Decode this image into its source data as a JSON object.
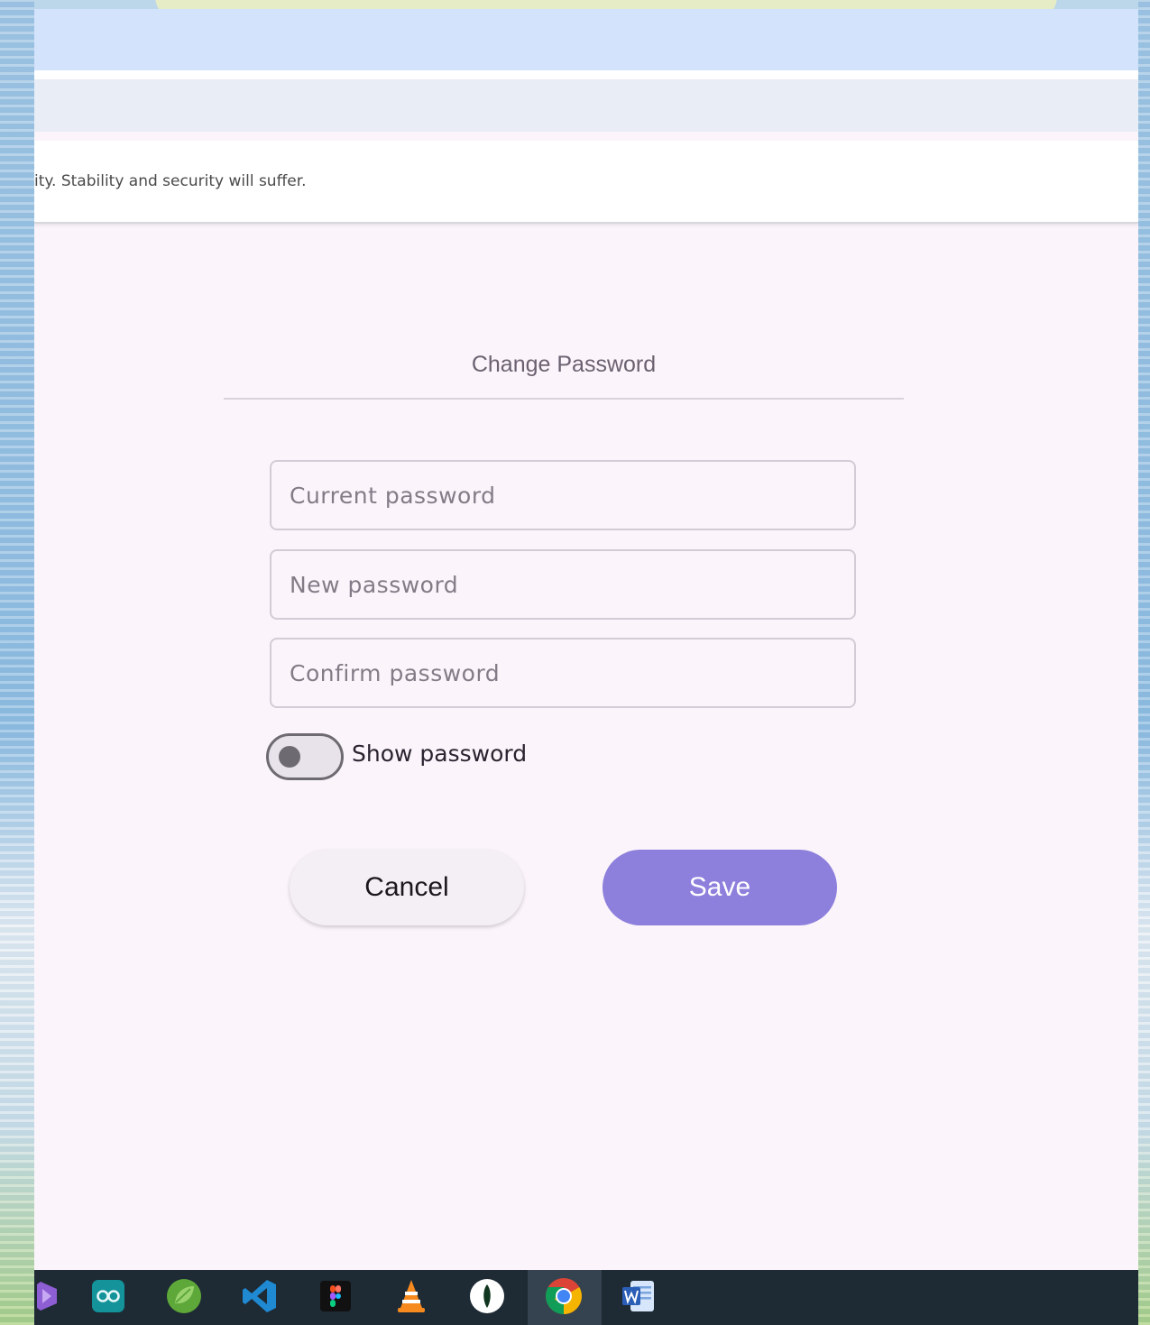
{
  "infobar": {
    "message": "ity. Stability and security will suffer."
  },
  "dialog": {
    "title": "Change Password",
    "fields": {
      "current_placeholder": "Current password",
      "new_placeholder": "New password",
      "confirm_placeholder": "Confirm password"
    },
    "show_password": {
      "label": "Show password",
      "checked": false
    },
    "buttons": {
      "cancel": "Cancel",
      "save": "Save"
    }
  },
  "colors": {
    "accent": "#8d7fdc",
    "surface": "#fbf4fb",
    "browser_top": "#d3e3fb",
    "taskbar": "#1e2a34"
  },
  "taskbar": {
    "apps": [
      "visual-studio-icon",
      "arduino-icon",
      "spring-icon",
      "vscode-icon",
      "figma-icon",
      "vlc-icon",
      "mongodb-compass-icon",
      "chrome-icon",
      "word-icon"
    ],
    "active_app": "chrome-icon"
  }
}
